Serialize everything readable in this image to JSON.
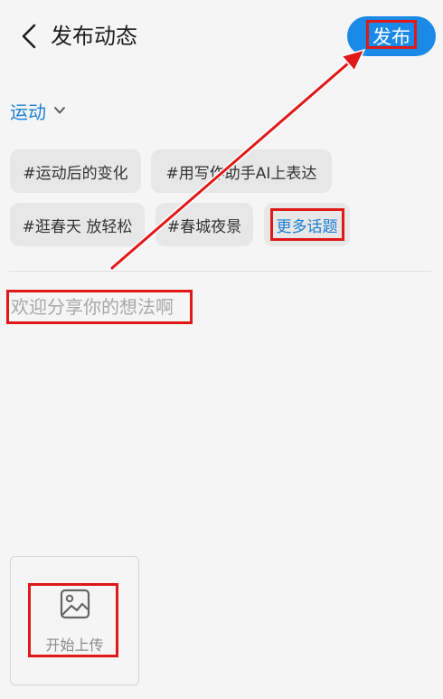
{
  "header": {
    "title": "发布动态",
    "publish_label": "发布"
  },
  "category": {
    "label": "运动"
  },
  "topics": {
    "row1": [
      "#运动后的变化",
      "#用写作助手AI上表达"
    ],
    "row2": [
      "#逛春天 放轻松",
      "#春城夜景"
    ],
    "more_label": "更多话题"
  },
  "editor": {
    "placeholder": "欢迎分享你的想法啊"
  },
  "upload": {
    "label": "开始上传"
  },
  "colors": {
    "accent": "#1a8ae8",
    "link": "#1a7fd6",
    "annotation": "#e01818"
  },
  "icons": {
    "back": "chevron-left-icon",
    "dropdown": "chevron-down-icon",
    "upload": "image-icon"
  }
}
